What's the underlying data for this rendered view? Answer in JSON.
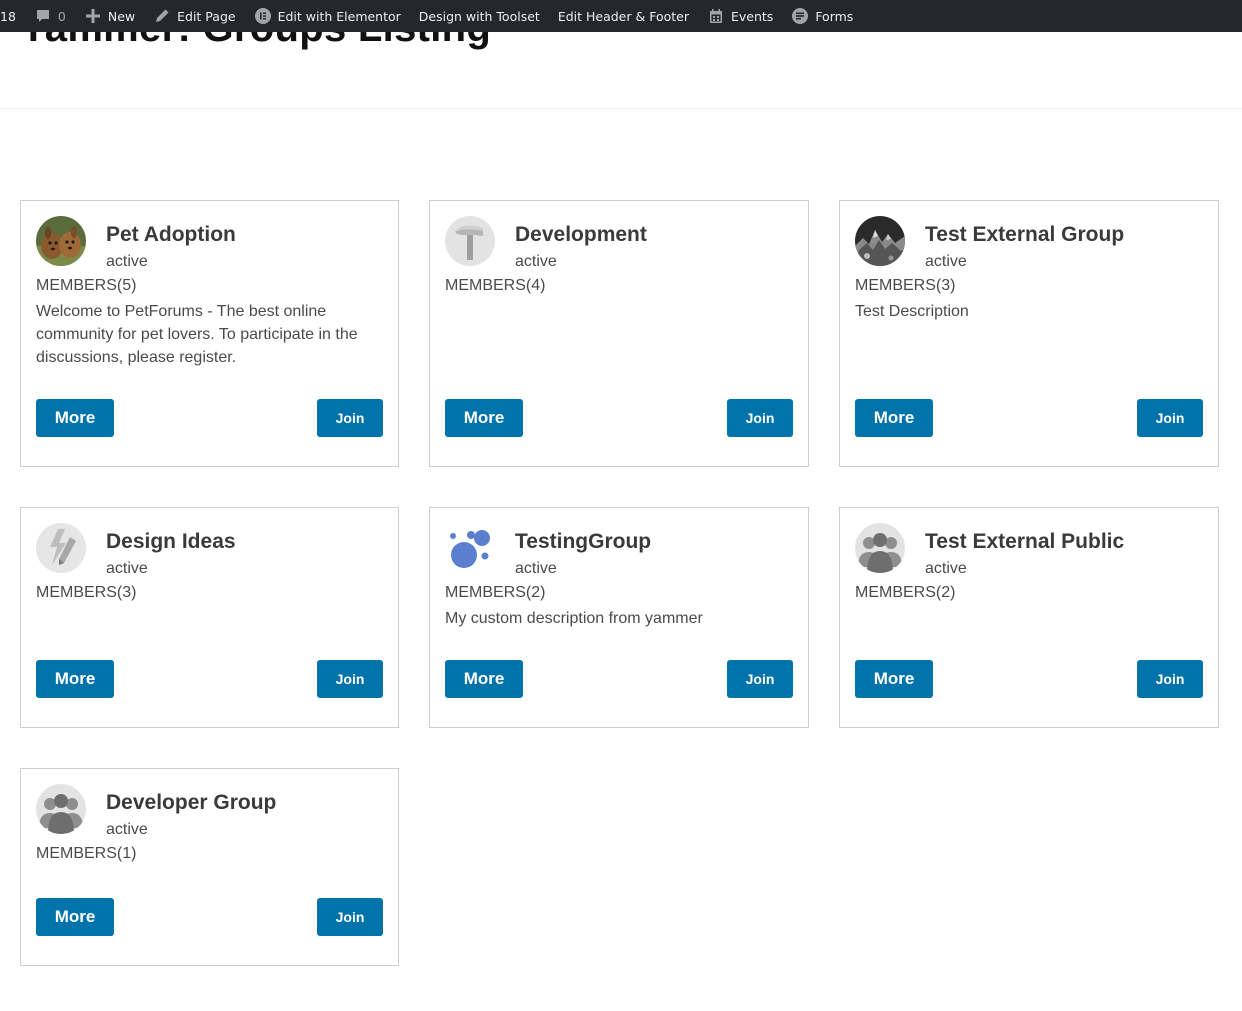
{
  "admin_bar": {
    "updates_count": "18",
    "comments_count": "0",
    "new_label": "New",
    "edit_page_label": "Edit Page",
    "elementor_label": "Edit with Elementor",
    "toolset_label": "Design with Toolset",
    "header_footer_label": "Edit Header & Footer",
    "events_label": "Events",
    "forms_label": "Forms"
  },
  "page": {
    "title": "Yammer: Groups Listing"
  },
  "groups": [
    {
      "name": "Pet Adoption",
      "status": "active",
      "members": "MEMBERS(5)",
      "description": "Welcome to PetForums - The best online community for pet lovers. To participate in the discussions, please register.",
      "avatar": "pets-photo-icon",
      "more_label": "More",
      "join_label": "Join"
    },
    {
      "name": "Development",
      "status": "active",
      "members": "MEMBERS(4)",
      "description": "",
      "avatar": "hammer-icon",
      "more_label": "More",
      "join_label": "Join"
    },
    {
      "name": "Test External Group",
      "status": "active",
      "members": "MEMBERS(3)",
      "description": "Test Description",
      "avatar": "dark-photo-icon",
      "more_label": "More",
      "join_label": "Join"
    },
    {
      "name": "Design Ideas",
      "status": "active",
      "members": "MEMBERS(3)",
      "description": "",
      "avatar": "lightning-pencil-icon",
      "more_label": "More",
      "join_label": "Join"
    },
    {
      "name": "TestingGroup",
      "status": "active",
      "members": "MEMBERS(2)",
      "description": "My custom description from yammer",
      "avatar": "bubbles-icon",
      "more_label": "More",
      "join_label": "Join"
    },
    {
      "name": "Test External Public",
      "status": "active",
      "members": "MEMBERS(2)",
      "description": "",
      "avatar": "people-group-icon",
      "more_label": "More",
      "join_label": "Join"
    },
    {
      "name": "Developer Group",
      "status": "active",
      "members": "MEMBERS(1)",
      "description": "",
      "avatar": "people-group-icon",
      "more_label": "More",
      "join_label": "Join"
    }
  ],
  "colors": {
    "admin_bar_bg": "#23282d",
    "button_bg": "#0073aa",
    "card_border": "#cfcfcf"
  }
}
